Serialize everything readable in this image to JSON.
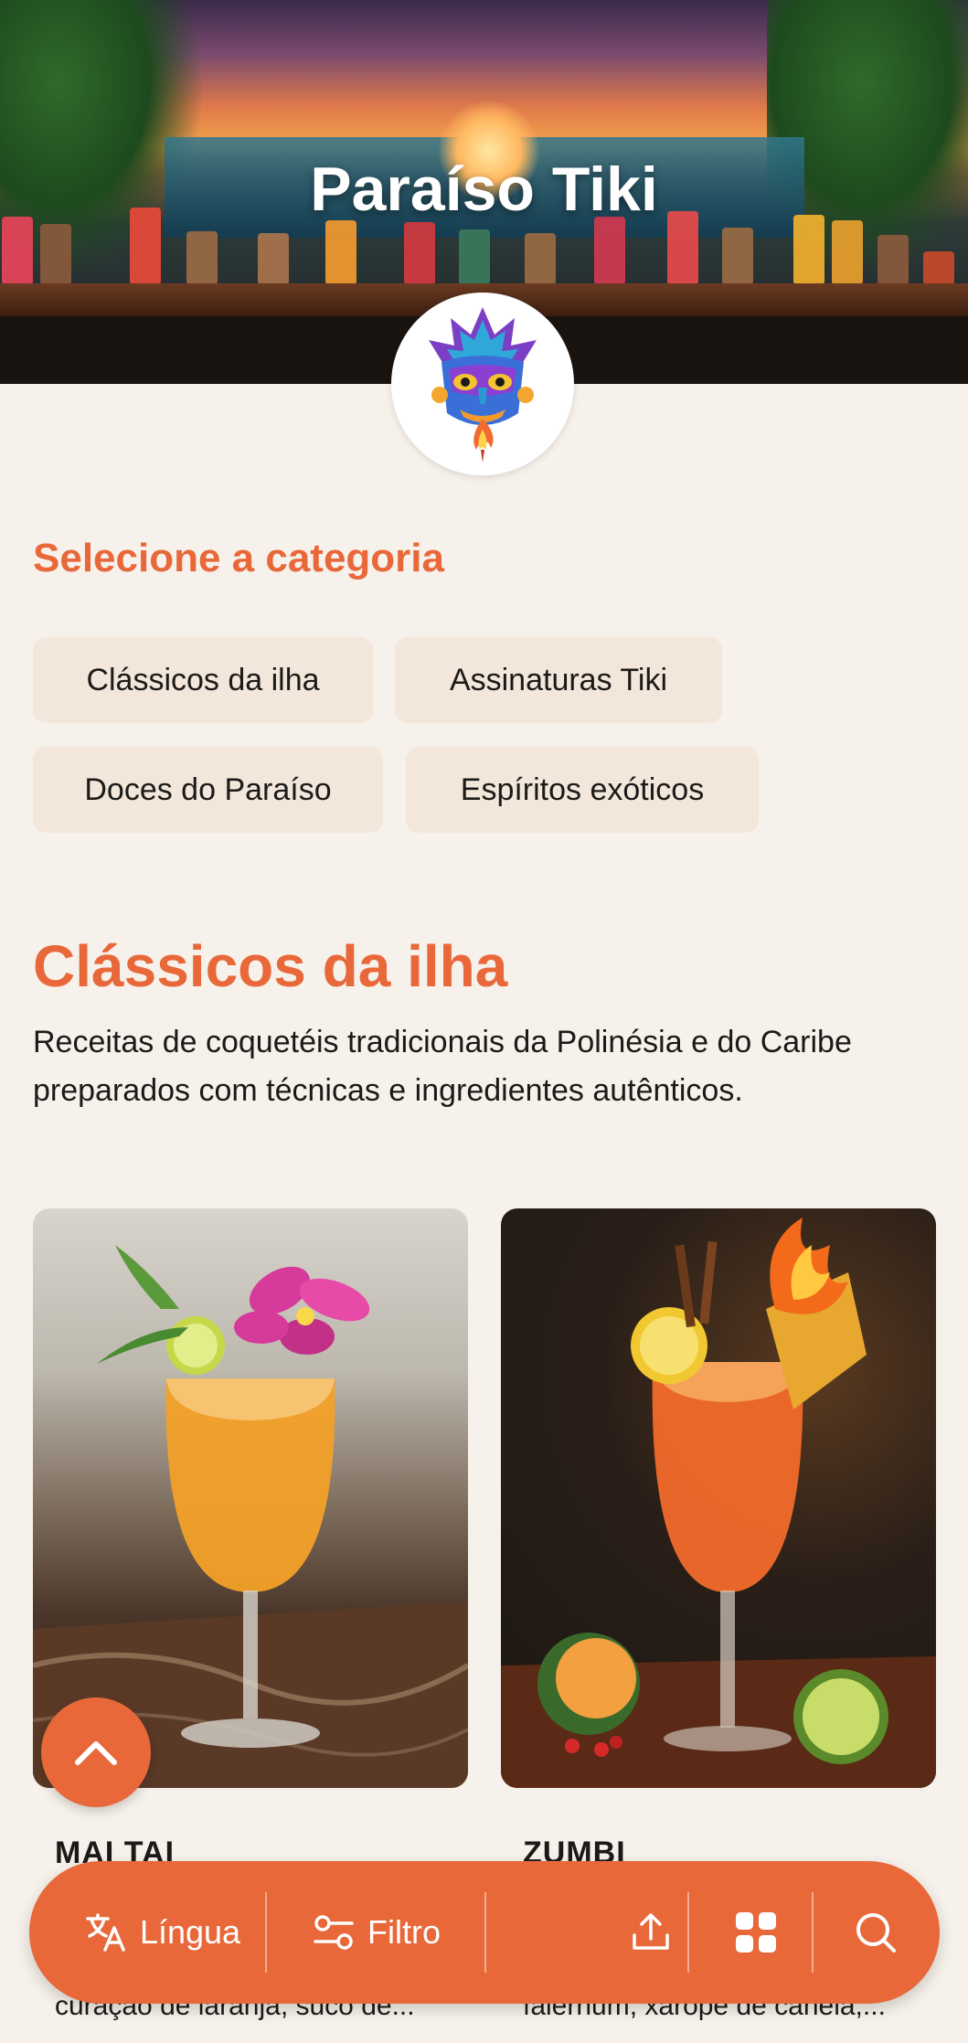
{
  "header": {
    "title": "Paraíso Tiki",
    "logo_icon": "tiki-mask-logo-icon"
  },
  "categories": {
    "heading": "Selecione a categoria",
    "items": [
      {
        "label": "Clássicos da ilha"
      },
      {
        "label": "Assinaturas Tiki"
      },
      {
        "label": "Doces do Paraíso"
      },
      {
        "label": "Espíritos exóticos"
      }
    ]
  },
  "section": {
    "title": "Clássicos da ilha",
    "description": "Receitas de coquetéis tradicionais da Polinésia e do Caribe preparados com técnicas e ingredientes autênticos."
  },
  "drinks": [
    {
      "name": "MAI TAI",
      "description": "curaçao de laranja, suco de...",
      "image_icon": "mai-tai-photo"
    },
    {
      "name": "ZUMBI",
      "description": "falernum, xarope de canela,...",
      "image_icon": "zumbi-photo"
    }
  ],
  "floating": {
    "scroll_top_icon": "chevron-up-icon"
  },
  "bottom_bar": {
    "language_label": "Língua",
    "filter_label": "Filtro",
    "icons": [
      "translate-icon",
      "sliders-icon",
      "share-icon",
      "grid-icon",
      "search-icon"
    ]
  },
  "colors": {
    "accent": "#e8683a",
    "background": "#f6f1ea",
    "chip": "#f3e7dc"
  }
}
